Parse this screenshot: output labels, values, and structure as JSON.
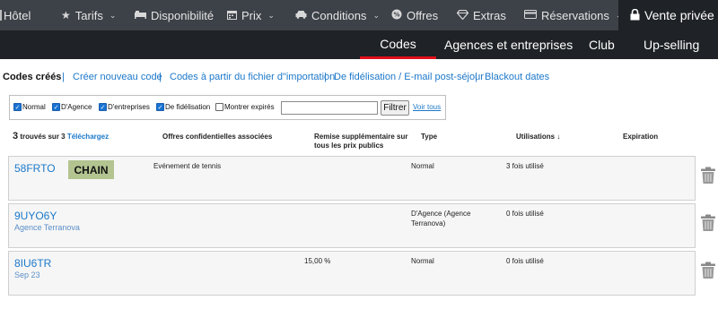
{
  "topnav": {
    "items": [
      {
        "label": "Hôtel",
        "icon": "hotel-icon"
      },
      {
        "label": "Tarifs",
        "icon": "star-icon"
      },
      {
        "label": "Disponibilité",
        "icon": "bed-icon"
      },
      {
        "label": "Prix",
        "icon": "calendar-icon"
      },
      {
        "label": "Conditions",
        "icon": "car-icon"
      },
      {
        "label": "Offres",
        "icon": "percent-icon"
      },
      {
        "label": "Extras",
        "icon": "diamond-icon"
      },
      {
        "label": "Réservations",
        "icon": "credit-card-icon"
      },
      {
        "label": "Vente privée",
        "icon": "lock-icon"
      }
    ]
  },
  "subnav": {
    "tabs": [
      {
        "label": "Codes"
      },
      {
        "label": "Agences et entreprises"
      },
      {
        "label": "Club"
      },
      {
        "label": "Up-selling"
      }
    ]
  },
  "codesnav": {
    "items": [
      "Codes créés",
      "Créer nouveau code",
      "Codes à partir du fichier d\"importation",
      "De fidélisation / E-mail post-séjour",
      "Blackout dates"
    ],
    "separator": "|"
  },
  "filters": {
    "checkboxes": [
      {
        "label": "Normal",
        "checked": true
      },
      {
        "label": "D'Agence",
        "checked": true
      },
      {
        "label": "D'entreprises",
        "checked": true
      },
      {
        "label": "De fidélisation",
        "checked": true
      },
      {
        "label": "Montrer expirés",
        "checked": false
      }
    ],
    "search_value": "",
    "filter_button": "Filtrer",
    "show_all": "Voir tous"
  },
  "results": {
    "count": "3",
    "found_text": "trouvés sur 3",
    "download": "Téléchargez"
  },
  "columns": {
    "offers": "Offres confidentielles associées",
    "discount_line1": "Remise supplémentaire sur",
    "discount_line2": "tous les prix publics",
    "type": "Type",
    "usage": "Utilisations ↓",
    "expiration": "Expiration"
  },
  "rows": [
    {
      "code": "58FRTO",
      "badge": "CHAIN",
      "sub": "",
      "offer": "Evénement de tennis",
      "discount": "",
      "type_line1": "Normal",
      "type_line2": "",
      "usage": "3 fois utilisé",
      "expiration": ""
    },
    {
      "code": "9UYO6Y",
      "badge": "",
      "sub": "Agence Terranova",
      "offer": "",
      "discount": "",
      "type_line1": "D'Agence (Agence",
      "type_line2": "Terranova)",
      "usage": "0 fois utilisé",
      "expiration": ""
    },
    {
      "code": "8IU6TR",
      "badge": "",
      "sub": "Sep 23",
      "offer": "",
      "discount": "15,00 %",
      "type_line1": "Normal",
      "type_line2": "",
      "usage": "0 fois utilisé",
      "expiration": ""
    }
  ],
  "colors": {
    "nav_bg": "#3d4148",
    "subnav_bg": "#1f2226",
    "active_underline": "#e0101a",
    "link": "#1c78c9",
    "badge_bg": "#b3c490"
  }
}
